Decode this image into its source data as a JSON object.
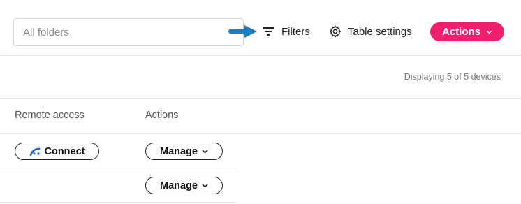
{
  "toolbar": {
    "folder_placeholder": "All folders",
    "filters_label": "Filters",
    "table_settings_label": "Table settings",
    "actions_label": "Actions",
    "accent_color": "#ee1f6c"
  },
  "status": {
    "displaying": "Displaying 5 of 5 devices"
  },
  "table": {
    "columns": [
      "Remote access",
      "Actions"
    ],
    "rows": [
      {
        "remote_access": "Connect",
        "action": "Manage"
      },
      {
        "remote_access": "",
        "action": "Manage"
      }
    ]
  }
}
